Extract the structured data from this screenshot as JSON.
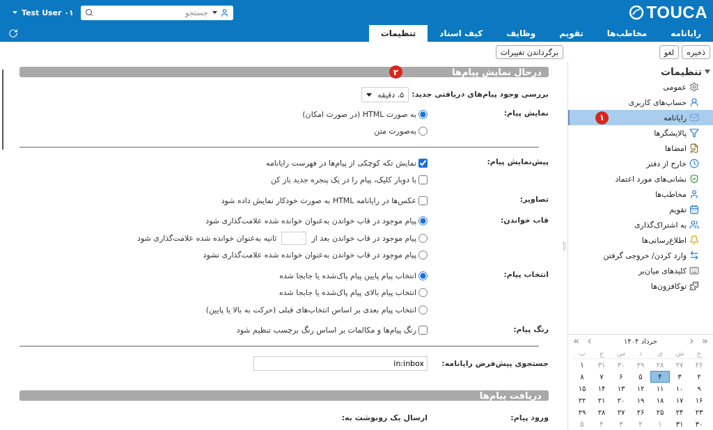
{
  "header": {
    "logo": "TOUCA",
    "user": "Test User ۰۱",
    "search": {
      "placeholder": "جستجو"
    }
  },
  "tabs": [
    {
      "label": "رایانامه",
      "selected": false
    },
    {
      "label": "مخاطب‌ها",
      "selected": false
    },
    {
      "label": "تقویم",
      "selected": false
    },
    {
      "label": "وظایف",
      "selected": false
    },
    {
      "label": "کیف اسناد",
      "selected": false
    },
    {
      "label": "تنظیمات",
      "selected": true
    }
  ],
  "toolbar": {
    "buttons": [
      "ذخیره",
      "لغو"
    ],
    "revert": "برگرداندن تغییرات"
  },
  "sidebar": {
    "title": "تنظیمات",
    "expanded": true,
    "items": [
      {
        "label": "عمومی",
        "selected": false
      },
      {
        "label": "حساب‌های کاربری",
        "selected": false
      },
      {
        "label": "رایانامه",
        "selected": true,
        "badge": "۱"
      },
      {
        "label": "پالایشگرها",
        "selected": false
      },
      {
        "label": "امضاها",
        "selected": false
      },
      {
        "label": "خارج از دفتر",
        "selected": false
      },
      {
        "label": "نشانی‌های مورد اعتماد",
        "selected": false
      },
      {
        "label": "مخاطب‌ها",
        "selected": false
      },
      {
        "label": "تقویم",
        "selected": false
      },
      {
        "label": "به اشتراک‌گذاری",
        "selected": false
      },
      {
        "label": "اطلاع‌رسانی‌ها",
        "selected": false
      },
      {
        "label": "وارد کردن/ خروجی گرفتن",
        "selected": false
      },
      {
        "label": "کلیدهای میان‌بر",
        "selected": false
      },
      {
        "label": "توکافزون‌ها",
        "selected": false
      }
    ]
  },
  "calendar": {
    "title": "خرداد ۱۴۰۴",
    "weekdays": [
      "ج",
      "ش",
      "ی",
      "د",
      "س",
      "چ",
      "پ"
    ],
    "weeks": [
      [
        {
          "day": "۲۶",
          "other_month": true,
          "selected": false
        },
        {
          "day": "۲۷",
          "other_month": true,
          "selected": false
        },
        {
          "day": "۲۸",
          "other_month": true,
          "selected": false
        },
        {
          "day": "۲۹",
          "other_month": true,
          "selected": false
        },
        {
          "day": "۳۰",
          "other_month": true,
          "selected": false
        },
        {
          "day": "۳۱",
          "other_month": true,
          "selected": false
        },
        {
          "day": "۱",
          "other_month": false,
          "selected": false
        }
      ],
      [
        {
          "day": "۲",
          "other_month": false,
          "selected": false
        },
        {
          "day": "۳",
          "other_month": false,
          "selected": false
        },
        {
          "day": "۴",
          "other_month": false,
          "selected": true
        },
        {
          "day": "۵",
          "other_month": false,
          "selected": false
        },
        {
          "day": "۶",
          "other_month": false,
          "selected": false
        },
        {
          "day": "۷",
          "other_month": false,
          "selected": false
        },
        {
          "day": "۸",
          "other_month": false,
          "selected": false
        }
      ],
      [
        {
          "day": "۹",
          "other_month": false,
          "selected": false
        },
        {
          "day": "۱۰",
          "other_month": false,
          "selected": false
        },
        {
          "day": "۱۱",
          "other_month": false,
          "selected": false
        },
        {
          "day": "۱۲",
          "other_month": false,
          "selected": false
        },
        {
          "day": "۱۳",
          "other_month": false,
          "selected": false
        },
        {
          "day": "۱۴",
          "other_month": false,
          "selected": false
        },
        {
          "day": "۱۵",
          "other_month": false,
          "selected": false
        }
      ],
      [
        {
          "day": "۱۶",
          "other_month": false,
          "selected": false
        },
        {
          "day": "۱۷",
          "other_month": false,
          "selected": false
        },
        {
          "day": "۱۸",
          "other_month": false,
          "selected": false
        },
        {
          "day": "۱۹",
          "other_month": false,
          "selected": false
        },
        {
          "day": "۲۰",
          "other_month": false,
          "selected": false
        },
        {
          "day": "۲۱",
          "other_month": false,
          "selected": false
        },
        {
          "day": "۲۲",
          "other_month": false,
          "selected": false
        }
      ],
      [
        {
          "day": "۲۳",
          "other_month": false,
          "selected": false
        },
        {
          "day": "۲۴",
          "other_month": false,
          "selected": false
        },
        {
          "day": "۲۵",
          "other_month": false,
          "selected": false
        },
        {
          "day": "۲۶",
          "other_month": false,
          "selected": false
        },
        {
          "day": "۲۷",
          "other_month": false,
          "selected": false
        },
        {
          "day": "۲۸",
          "other_month": false,
          "selected": false
        },
        {
          "day": "۲۹",
          "other_month": false,
          "selected": false
        }
      ],
      [
        {
          "day": "۳۰",
          "other_month": false,
          "selected": false
        },
        {
          "day": "۳۱",
          "other_month": false,
          "selected": false
        },
        {
          "day": "۱",
          "other_month": true,
          "selected": false
        },
        {
          "day": "۲",
          "other_month": true,
          "selected": false
        },
        {
          "day": "۳",
          "other_month": true,
          "selected": false
        },
        {
          "day": "۴",
          "other_month": true,
          "selected": false
        },
        {
          "day": "۵",
          "other_month": true,
          "selected": false
        }
      ]
    ]
  },
  "sections": [
    {
      "title": "درحال نمایش پیام‌ها",
      "badge": "۲",
      "rows": [
        {
          "kind": "select",
          "label": "بررسی وجود پیام‌های دریافتی جدید:",
          "value": "۵، دقیقه"
        },
        {
          "kind": "radio",
          "label": "نمایش پیام:",
          "options": [
            {
              "text": "به صورت HTML (در صورت امکان)",
              "selected": true
            },
            {
              "text": "به‌صورت متن",
              "selected": false
            }
          ]
        },
        {
          "kind": "divider"
        },
        {
          "kind": "checkbox",
          "label": "پیش‌نمایش پیام:",
          "options": [
            {
              "text": "نمایش تکه کوچکی از پیام‌ها در فهرست رایانامه",
              "checked": true
            },
            {
              "text": "با دوبار کلیک، پیام را در یک پنجره جدید باز کن",
              "checked": false
            }
          ]
        },
        {
          "kind": "checkbox",
          "label": "تصاویر:",
          "options": [
            {
              "text": "عکس‌ها در رایانامه HTML به صورت خودکار نمایش داده شود",
              "checked": false
            }
          ]
        },
        {
          "kind": "radio",
          "label": "قاب خواندن:",
          "options": [
            {
              "text": "پیام موجود در قاب خواندن به‌عنوان خوانده شده علامت‌گذاری شود",
              "selected": true
            },
            {
              "text": "پیام موجود در قاب خواندن بعد از",
              "field_placeholder": "۰",
              "text_after": "ثانیه به‌عنوان خوانده شده علامت‌گذاری شود",
              "selected": false
            },
            {
              "text": "پیام موجود در قاب خواندن به‌عنوان خوانده شده علامت‌گذاری نشود",
              "selected": false
            }
          ]
        },
        {
          "kind": "radio",
          "label": "انتخاب پیام:",
          "options": [
            {
              "text": "انتخاب پیام پایین پیام پاک‌شده یا جابجا شده",
              "selected": true
            },
            {
              "text": "انتخاب پیام بالای پیام پاک‌شده یا جابجا شده",
              "selected": false
            },
            {
              "text": "انتخاب پیام بعدی بر اساس انتخاب‌های قبلی (حرکت به بالا یا پایین)",
              "selected": false
            }
          ]
        },
        {
          "kind": "checkbox",
          "label": "رنگ پیام:",
          "options": [
            {
              "text": "رنگ پیام‌ها و مکالمات بر اساس رنگ برچسب تنظیم شود",
              "checked": false
            }
          ]
        },
        {
          "kind": "divider"
        },
        {
          "kind": "text",
          "label": "جستجوی پیش‌فرض رایانامه:",
          "value": "in:inbox"
        }
      ]
    },
    {
      "title": "دریافت پیام‌ها",
      "rows": [
        {
          "kind": "plain",
          "label": "ورود پیام:",
          "value": "ارسال یک رونوشت به:"
        }
      ]
    }
  ]
}
